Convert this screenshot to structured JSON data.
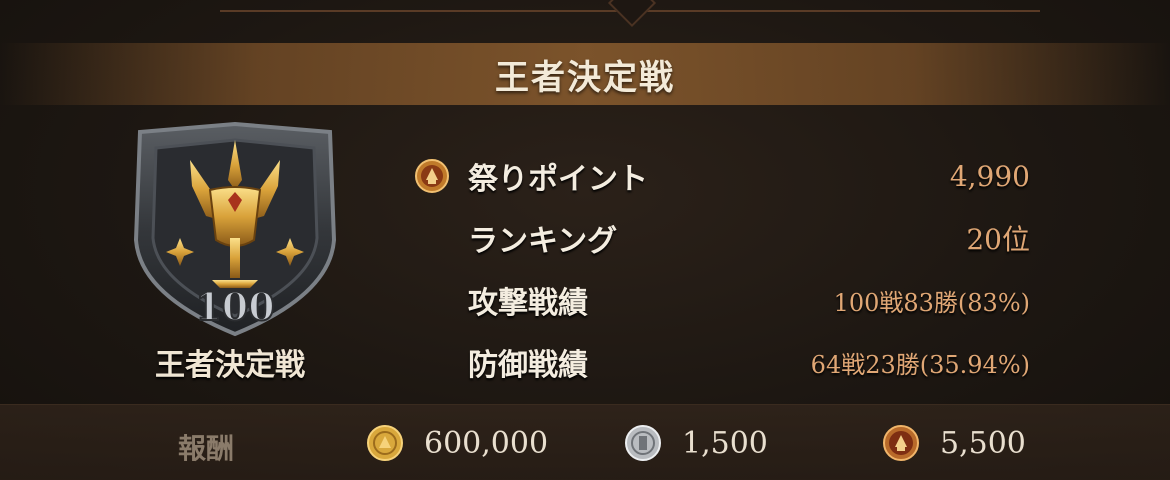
{
  "title": "王者決定戦",
  "emblem": {
    "rank_number": "100",
    "name": "王者決定戦"
  },
  "stats": [
    {
      "icon": "festival-point-icon",
      "label": "祭りポイント",
      "value": "4,990"
    },
    {
      "icon": "",
      "label": "ランキング",
      "value": "20位"
    },
    {
      "icon": "",
      "label": "攻撃戦績",
      "value": "100戦83勝(83%)"
    },
    {
      "icon": "",
      "label": "防御戦績",
      "value": "64戦23勝(35.94%)"
    }
  ],
  "rewards": {
    "label": "報酬",
    "items": [
      {
        "icon": "gold-coin-icon",
        "amount": "600,000"
      },
      {
        "icon": "silver-coin-icon",
        "amount": "1,500"
      },
      {
        "icon": "festival-medal-icon",
        "amount": "5,500"
      }
    ]
  },
  "colors": {
    "value_accent": "#e0a775",
    "title_band": "#80562c",
    "background": "#1d1712"
  }
}
